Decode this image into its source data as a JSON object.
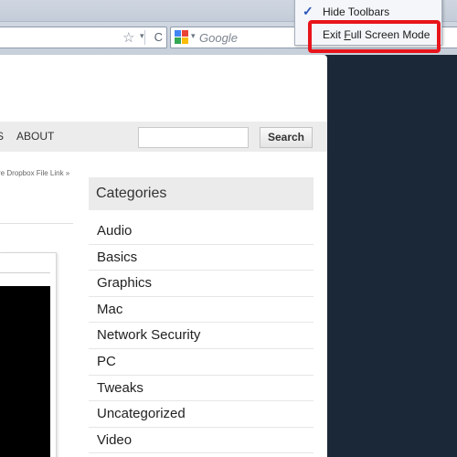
{
  "browser": {
    "search_placeholder": "Google",
    "menu": {
      "items": [
        {
          "label": "Hide Toolbars",
          "checked": true
        },
        {
          "label": "Exit Full Screen Mode",
          "checked": false
        }
      ]
    }
  },
  "site": {
    "nav": {
      "partial_item": "S",
      "about_label": "ABOUT",
      "search_button": "Search"
    },
    "breadcrumb": "re Dropbox File Link »",
    "sidebar": {
      "heading": "Categories",
      "categories": [
        "Audio",
        "Basics",
        "Graphics",
        "Mac",
        "Network Security",
        "PC",
        "Tweaks",
        "Uncategorized",
        "Video"
      ]
    }
  },
  "colors": {
    "highlight": "#e8141b",
    "dark_background": "#1b2837"
  }
}
